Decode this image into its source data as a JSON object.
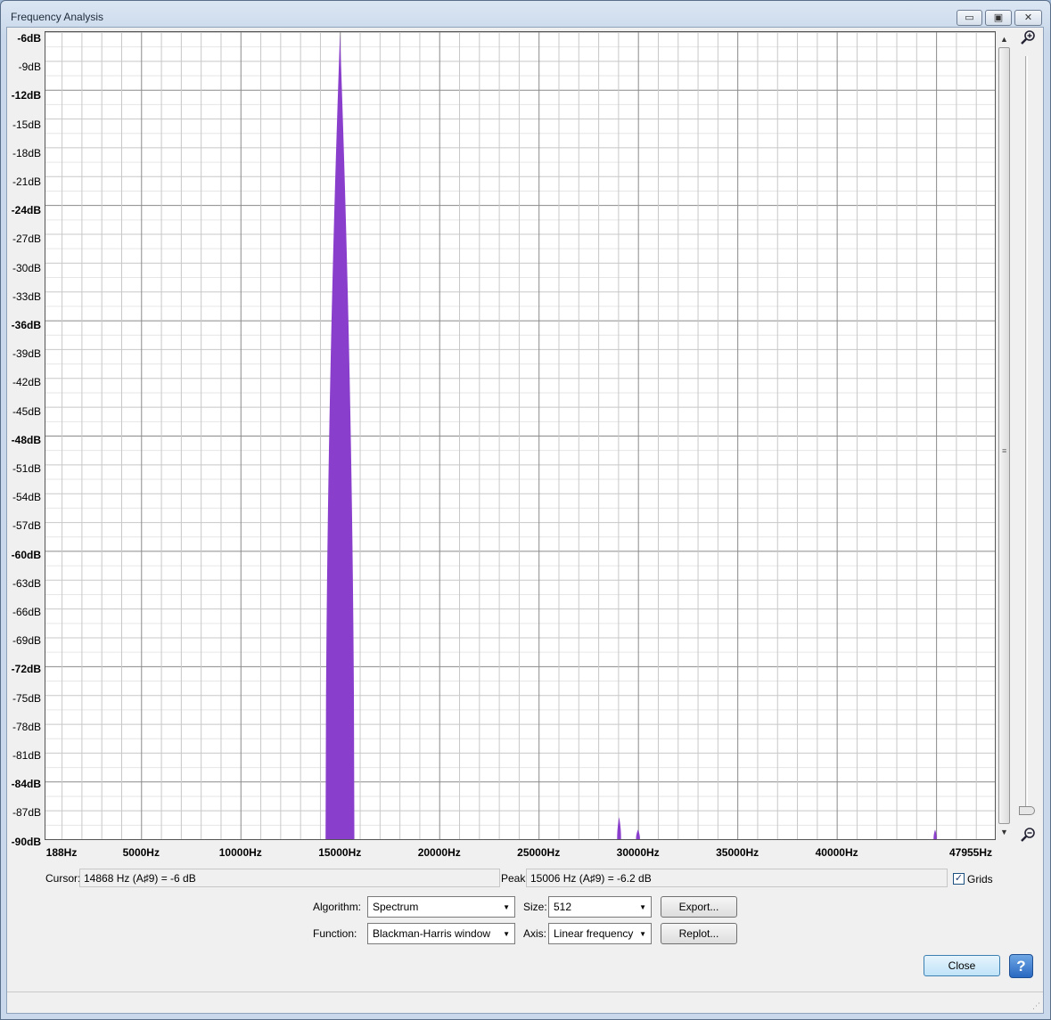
{
  "window": {
    "title": "Frequency Analysis"
  },
  "captions": {
    "minimize": "▭",
    "maximize": "▣",
    "close": "✕"
  },
  "yaxis": {
    "labels": [
      "-6dB",
      "-9dB",
      "-12dB",
      "-15dB",
      "-18dB",
      "-21dB",
      "-24dB",
      "-27dB",
      "-30dB",
      "-33dB",
      "-36dB",
      "-39dB",
      "-42dB",
      "-45dB",
      "-48dB",
      "-51dB",
      "-54dB",
      "-57dB",
      "-60dB",
      "-63dB",
      "-66dB",
      "-69dB",
      "-72dB",
      "-75dB",
      "-78dB",
      "-81dB",
      "-84dB",
      "-87dB",
      "-90dB"
    ],
    "major": [
      "-6dB",
      "-12dB",
      "-24dB",
      "-36dB",
      "-48dB",
      "-60dB",
      "-72dB",
      "-84dB",
      "-90dB"
    ]
  },
  "xaxis": {
    "labels": [
      {
        "text": "188Hz",
        "hz": 188
      },
      {
        "text": "5000Hz",
        "hz": 5000
      },
      {
        "text": "10000Hz",
        "hz": 10000
      },
      {
        "text": "15000Hz",
        "hz": 15000
      },
      {
        "text": "20000Hz",
        "hz": 20000
      },
      {
        "text": "25000Hz",
        "hz": 25000
      },
      {
        "text": "30000Hz",
        "hz": 30000
      },
      {
        "text": "35000Hz",
        "hz": 35000
      },
      {
        "text": "40000Hz",
        "hz": 40000
      },
      {
        "text": "47955Hz",
        "hz": 47955
      }
    ]
  },
  "chart_data": {
    "type": "area",
    "xlim": [
      188,
      47955
    ],
    "ylim": [
      -90,
      -6
    ],
    "color": "#8a3fcc",
    "grid": true,
    "peaks": [
      {
        "center_hz": 15006,
        "top_db": -6.2,
        "width_hz": 1450
      },
      {
        "center_hz": 29050,
        "top_db": -87.7,
        "width_hz": 200
      },
      {
        "center_hz": 30000,
        "top_db": -89.0,
        "width_hz": 200
      },
      {
        "center_hz": 44950,
        "top_db": -89.0,
        "width_hz": 160
      }
    ]
  },
  "readout": {
    "cursor_label": "Cursor:",
    "cursor_value": "14868 Hz (A♯9) = -6 dB",
    "peak_label": "Peak:",
    "peak_value": "15006 Hz (A♯9) = -6.2 dB",
    "grids_label": "Grids",
    "grids_checked": true
  },
  "controls": {
    "algorithm_label": "Algorithm:",
    "algorithm_value": "Spectrum",
    "function_label": "Function:",
    "function_value": "Blackman-Harris window",
    "size_label": "Size:",
    "size_value": "512",
    "axis_label": "Axis:",
    "axis_value": "Linear frequency",
    "export_label": "Export...",
    "replot_label": "Replot...",
    "close_label": "Close",
    "help_label": "?"
  }
}
